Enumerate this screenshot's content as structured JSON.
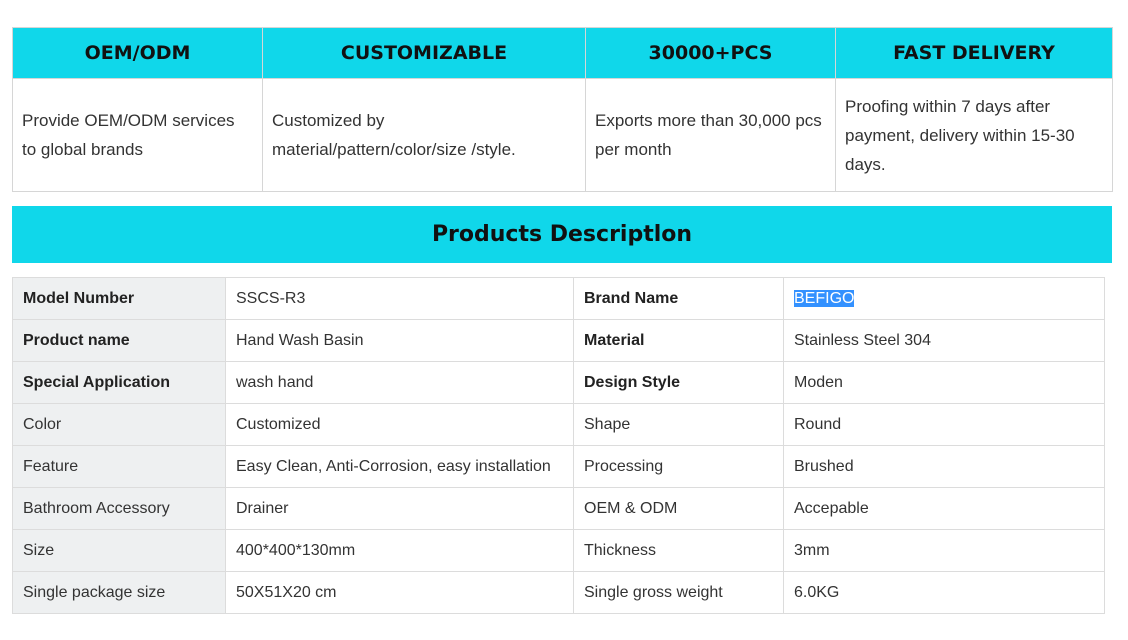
{
  "features": {
    "headers": [
      "OEM/ODM",
      "CUSTOMIZABLE",
      "30000+PCS",
      "FAST DELIVERY"
    ],
    "bodies": [
      "Provide OEM/ODM services to global brands",
      "Customized by material/pattern/color/size /style.",
      "Exports more than 30,000 pcs per month",
      "Proofing within 7 days after payment, delivery within 15-30 days."
    ]
  },
  "banner": {
    "title": "Products Descriptlon"
  },
  "specs": {
    "rows": [
      {
        "l1": "Model Number",
        "v1": "SSCS-R3",
        "l2": "Brand Name",
        "v2": "BEFIGO"
      },
      {
        "l1": "Product name",
        "v1": "Hand Wash Basin",
        "l2": "Material",
        "v2": "Stainless Steel 304"
      },
      {
        "l1": "Special Application",
        "v1": "wash hand",
        "l2": "Design Style",
        "v2": "Moden"
      },
      {
        "l1": "Color",
        "v1": "Customized",
        "l2": "Shape",
        "v2": "Round"
      },
      {
        "l1": "Feature",
        "v1": "Easy Clean, Anti-Corrosion, easy installation",
        "l2": "Processing",
        "v2": "Brushed"
      },
      {
        "l1": "Bathroom Accessory",
        "v1": "Drainer",
        "l2": "OEM & ODM",
        "v2": "Accepable"
      },
      {
        "l1": "Size",
        "v1": "400*400*130mm",
        "l2": "Thickness",
        "v2": "3mm"
      },
      {
        "l1": "Single package size",
        "v1": "50X51X20 cm",
        "l2": "Single gross weight",
        "v2": "6.0KG"
      }
    ]
  },
  "colors": {
    "accent": "#10d7ea",
    "label_bg": "#eef0f1",
    "selection": "#3391ff"
  }
}
